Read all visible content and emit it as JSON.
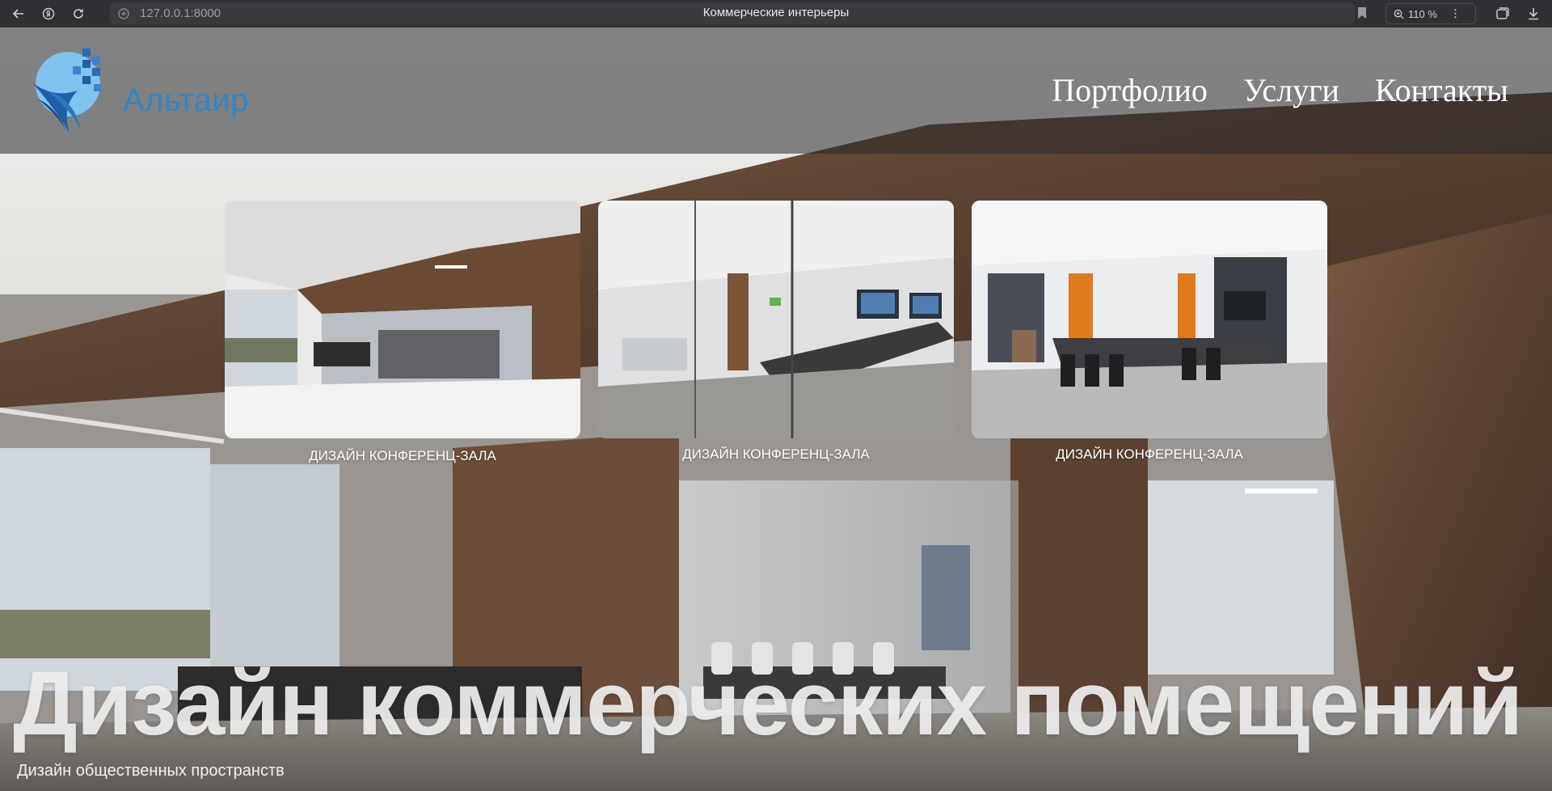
{
  "browser": {
    "url": "127.0.0.1:8000",
    "tab_title": "Коммерческие интерьеры",
    "zoom": "110 %"
  },
  "header": {
    "logo_text": "Альтаир",
    "nav": [
      "Портфолио",
      "Услуги",
      "Контакты"
    ]
  },
  "cards": [
    {
      "caption": "Дизайн конференц-зала"
    },
    {
      "caption": "Дизайн конференц-зала"
    },
    {
      "caption": "Дизайн конференц-зала"
    }
  ],
  "hero": {
    "title": "Дизайн коммерческих помещений",
    "subtitle": "Дизайн общественных пространств"
  },
  "colors": {
    "logo_blue": "#2f86c8",
    "header_overlay": "#28282a",
    "chrome_bg": "#2f3035"
  }
}
